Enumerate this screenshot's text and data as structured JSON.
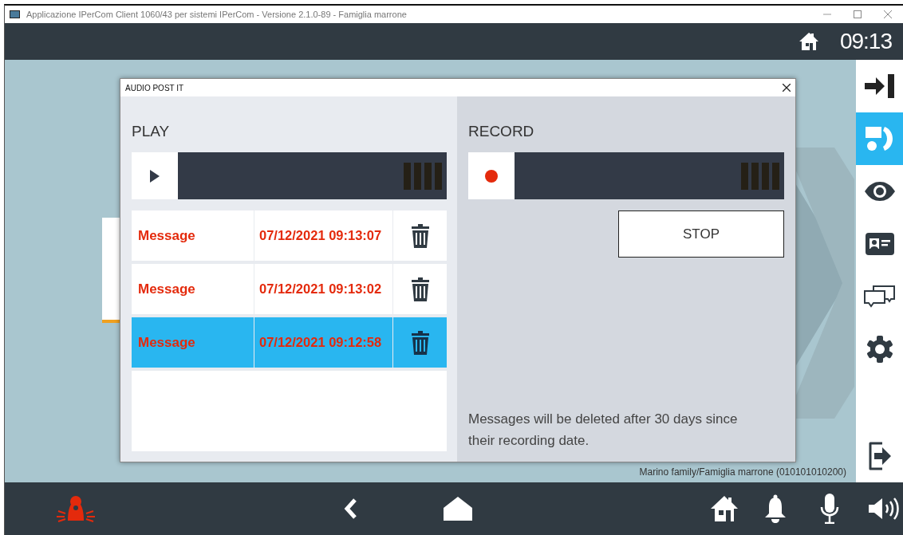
{
  "window": {
    "title": "Applicazione IPerCom Client 1060/43 per sistemi IPerCom - Versione 2.1.0-89 - Famiglia marrone"
  },
  "top_bar": {
    "time": "09:13"
  },
  "sidebar": {
    "items": [
      {
        "kind": "enter",
        "selected": false
      },
      {
        "kind": "intercom",
        "selected": true
      },
      {
        "kind": "eye",
        "selected": false
      },
      {
        "kind": "contact",
        "selected": false
      },
      {
        "kind": "chat",
        "selected": false
      },
      {
        "kind": "gear",
        "selected": false
      },
      {
        "kind": "exit",
        "selected": false
      }
    ]
  },
  "dialog": {
    "title": "AUDIO POST IT",
    "play": {
      "heading": "PLAY"
    },
    "messages": [
      {
        "label": "Message",
        "date": "07/12/2021 09:13:07",
        "selected": false
      },
      {
        "label": "Message",
        "date": "07/12/2021 09:13:02",
        "selected": false
      },
      {
        "label": "Message",
        "date": "07/12/2021 09:12:58",
        "selected": true
      }
    ],
    "record": {
      "heading": "RECORD",
      "button": "STOP",
      "note": "Messages will be deleted after 30 days since their recording date."
    }
  },
  "status_text": "Marino family/Famiglia marrone (010101010200)",
  "bottom_bar": {
    "items": [
      {
        "kind": "alarm"
      },
      {
        "kind": "back"
      },
      {
        "kind": "home"
      },
      {
        "kind": "house"
      },
      {
        "kind": "bell"
      },
      {
        "kind": "mic"
      },
      {
        "kind": "speaker"
      }
    ]
  }
}
